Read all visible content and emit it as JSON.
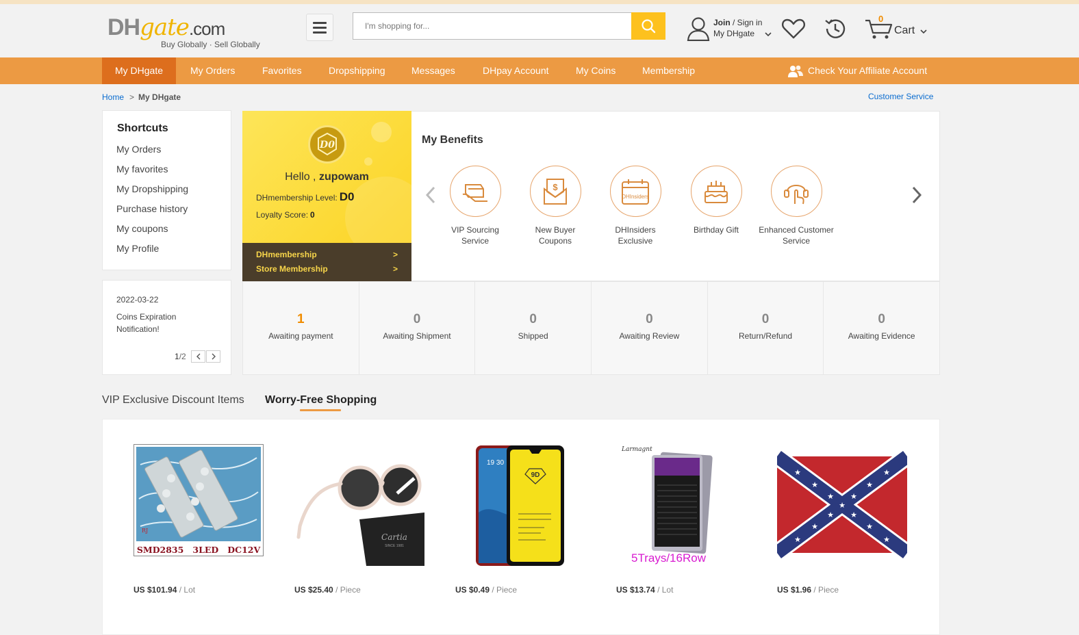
{
  "header": {
    "logo_dh": "DH",
    "logo_gate": "gate",
    "logo_com": ".com",
    "tagline": "Buy Globally · Sell Globally",
    "search_placeholder": "I'm shopping for...",
    "join_label": "Join",
    "signin_label": "/ Sign in",
    "my_dhgate_label": "My DHgate",
    "cart_count": "0",
    "cart_label": "Cart"
  },
  "nav": {
    "items": [
      "My DHgate",
      "My Orders",
      "Favorites",
      "Dropshipping",
      "Messages",
      "DHpay Account",
      "My Coins",
      "Membership"
    ],
    "affiliate": "Check Your Affiliate Account"
  },
  "breadcrumb": {
    "home": "Home",
    "sep": ">",
    "current": "My DHgate",
    "customer_service": "Customer Service"
  },
  "shortcuts": {
    "title": "Shortcuts",
    "items": [
      "My Orders",
      "My favorites",
      "My Dropshipping",
      "Purchase history",
      "My coupons",
      "My Profile"
    ]
  },
  "notice": {
    "date": "2022-03-22",
    "message": "Coins Expiration Notification!",
    "page_current": "1",
    "page_total": "/2"
  },
  "member": {
    "badge_text": "D0",
    "hello": "Hello ,",
    "username": "zupowam",
    "level_label": "DHmembership Level:",
    "level_value": "D0",
    "score_label": "Loyalty Score:",
    "score_value": "0",
    "links": [
      "DHmembership",
      "Store Membership"
    ]
  },
  "benefits": {
    "title": "My Benefits",
    "items": [
      {
        "label": "VIP Sourcing Service",
        "icon": "vip-sourcing-icon"
      },
      {
        "label": "New Buyer Coupons",
        "icon": "coupon-icon"
      },
      {
        "label": "DHInsiders Exclusive",
        "icon": "calendar-icon",
        "icon_text": "DHInsiders"
      },
      {
        "label": "Birthday Gift",
        "icon": "cake-icon"
      },
      {
        "label": "Enhanced Customer Service",
        "icon": "service-hand-icon"
      }
    ]
  },
  "order_status": [
    {
      "count": "1",
      "label": "Awaiting payment",
      "highlight": true
    },
    {
      "count": "0",
      "label": "Awaiting Shipment"
    },
    {
      "count": "0",
      "label": "Shipped"
    },
    {
      "count": "0",
      "label": "Awaiting Review"
    },
    {
      "count": "0",
      "label": "Return/Refund"
    },
    {
      "count": "0",
      "label": "Awaiting Evidence"
    }
  ],
  "tabs": [
    "VIP Exclusive Discount Items",
    "Worry-Free Shopping"
  ],
  "products": [
    {
      "price": "US $101.94",
      "unit": "/ Lot",
      "image_text": "SMD2835   3LED   DC12V",
      "image_mark": "RJ"
    },
    {
      "price": "US $25.40",
      "unit": "/ Piece",
      "image_text": "Cartia",
      "image_sub": "SINCE 1981"
    },
    {
      "price": "US $0.49",
      "unit": "/ Piece",
      "image_text": "9D",
      "time_text": "19 30"
    },
    {
      "price": "US $13.74",
      "unit": "/ Lot",
      "image_text": "5Trays/16Row",
      "brand": "Larmagnt"
    },
    {
      "price": "US $1.96",
      "unit": "/ Piece"
    }
  ],
  "colors": {
    "nav_bg": "#ec9a43",
    "nav_active": "#dd6e1d",
    "search_btn": "#fdc11e",
    "link_blue": "#0a6ccf",
    "accent_orange": "#f08c00",
    "member_yellow": "#fcd21e"
  }
}
